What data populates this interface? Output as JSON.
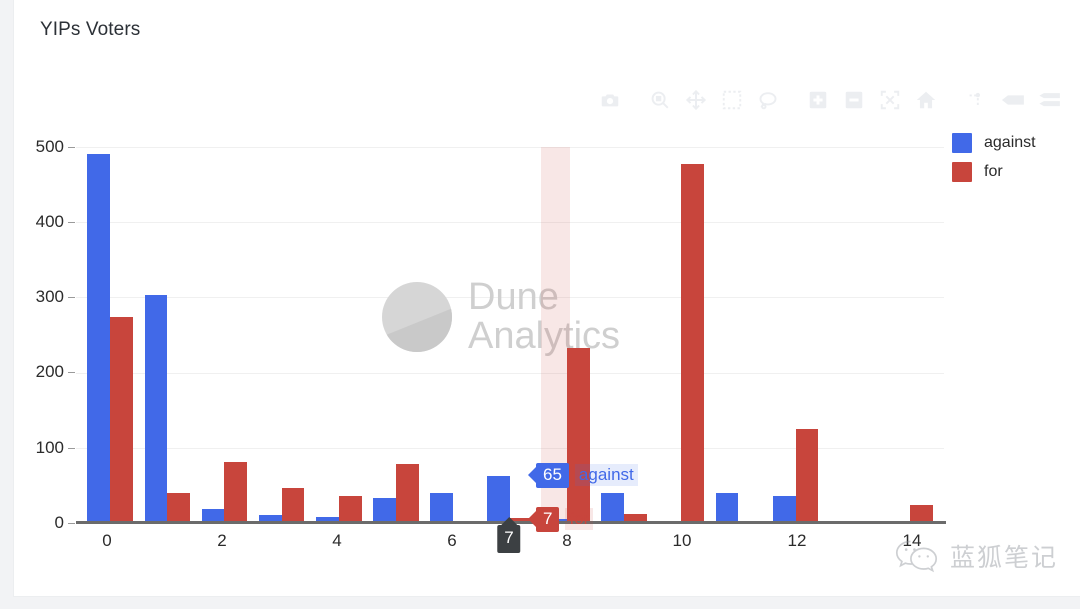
{
  "chart_title": "YIPs Voters",
  "colors": {
    "against": "#4169e8",
    "for": "#c8453c",
    "title_text": "#2c3137",
    "tick_text": "#2b2b2b",
    "gridline": "#f0f0f0",
    "axis_line": "#6b6b6b",
    "card_bg": "#ffffff",
    "page_bg": "#f2f3f5",
    "spike_label_bg": "#3c4043"
  },
  "legend": {
    "position": "top-right",
    "items": [
      {
        "label": "against",
        "color": "#4169e8"
      },
      {
        "label": "for",
        "color": "#c8453c"
      }
    ]
  },
  "modebar": {
    "buttons": [
      {
        "name": "download-camera-icon",
        "title": "Download plot as a png"
      },
      {
        "name": "zoom-magnifier-icon",
        "title": "Zoom"
      },
      {
        "name": "pan-move-icon",
        "title": "Pan"
      },
      {
        "name": "box-select-icon",
        "title": "Box Select"
      },
      {
        "name": "lasso-select-icon",
        "title": "Lasso Select"
      },
      {
        "name": "zoom-in-plus-icon",
        "title": "Zoom in"
      },
      {
        "name": "zoom-out-minus-icon",
        "title": "Zoom out"
      },
      {
        "name": "autoscale-icon",
        "title": "Autoscale"
      },
      {
        "name": "reset-axes-home-icon",
        "title": "Reset axes"
      },
      {
        "name": "toggle-spike-lines-icon",
        "title": "Toggle Spike Lines"
      },
      {
        "name": "hover-closest-icon",
        "title": "Show closest data on hover"
      },
      {
        "name": "hover-compare-icon",
        "title": "Compare data on hover"
      }
    ]
  },
  "watermark": {
    "line1": "Dune",
    "line2": "Analytics"
  },
  "wechat_watermark": {
    "label": "蓝狐笔记"
  },
  "hover": {
    "x_spike_label": "7",
    "tooltips": [
      {
        "value": "65",
        "name": "against",
        "color": "#4169e8"
      },
      {
        "value": "7",
        "name": "for",
        "color": "#c8453c"
      }
    ]
  },
  "chart_data": {
    "type": "bar",
    "title": "YIPs Voters",
    "xlabel": "",
    "ylabel": "",
    "barmode": "group",
    "grid": true,
    "legend_position": "top-right",
    "xlim": [
      -0.6,
      14.6
    ],
    "ylim": [
      0,
      520
    ],
    "x": [
      0,
      1,
      2,
      3,
      4,
      5,
      6,
      7,
      8,
      9,
      10,
      11,
      12,
      13,
      14
    ],
    "xticks": [
      0,
      2,
      4,
      6,
      8,
      10,
      12,
      14
    ],
    "yticks": [
      0,
      100,
      200,
      300,
      400,
      500
    ],
    "categories": [
      "0",
      "1",
      "2",
      "3",
      "4",
      "5",
      "6",
      "7",
      "8",
      "9",
      "10",
      "11",
      "12",
      "13",
      "14"
    ],
    "series": [
      {
        "name": "against",
        "color": "#4169e8",
        "values": [
          510,
          315,
          19,
          11,
          8,
          35,
          41,
          65,
          5,
          41,
          0,
          41,
          37,
          3,
          3
        ]
      },
      {
        "name": "for",
        "color": "#c8453c",
        "values": [
          285,
          42,
          85,
          48,
          37,
          82,
          0,
          7,
          242,
          12,
          497,
          0,
          130,
          2,
          25
        ]
      }
    ],
    "hovered_x": 7,
    "hovered_values": {
      "against": 65,
      "for": 7
    }
  }
}
